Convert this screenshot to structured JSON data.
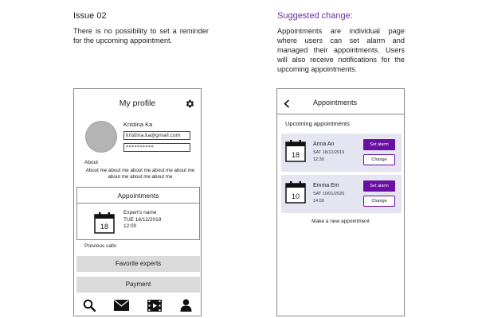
{
  "issue": {
    "title": "Issue 02",
    "body": "There is no possibility to set a reminder for the upcoming appointment."
  },
  "suggestion": {
    "title": "Suggested change:",
    "title_color": "#6d2ca3",
    "body": "Appointments are individual page where users can set alarm and managed their appointments. Users will also receive notifications for the upcoming appointments."
  },
  "profile_screen": {
    "title": "My profile",
    "user_name": "Kristina Ka",
    "email": "kristina.ka@gmail.com",
    "password_mask": "**********",
    "about_label": "About",
    "about_text": "About me about me about me about me about me about me about me about me",
    "appointments_title": "Appointments",
    "appointment": {
      "day": "18",
      "expert": "Expert's name",
      "date": "TUE 18/12/2019",
      "time": "12:00"
    },
    "previous_calls_label": "Previous calls",
    "favorite_experts_label": "Favorite experts",
    "payment_label": "Payment",
    "nav_icons": [
      "search-icon",
      "mail-icon",
      "video-icon",
      "user-icon"
    ]
  },
  "appointments_screen": {
    "title": "Appointments",
    "upcoming_label": "Upcoming appointments",
    "items": [
      {
        "day": "18",
        "name": "Anna An",
        "date": "SAT 18/12/2019",
        "time": "12:30",
        "alarm_label": "Set alarm",
        "change_label": "Change"
      },
      {
        "day": "10",
        "name": "Emma Em",
        "date": "SAT 10/01/2020",
        "time": "14:00",
        "alarm_label": "Set alarm",
        "change_label": "Change"
      }
    ],
    "new_appointment_label": "Make a new appointment",
    "accent_color": "#6a0fa3",
    "card_color": "#e5e4f1"
  }
}
